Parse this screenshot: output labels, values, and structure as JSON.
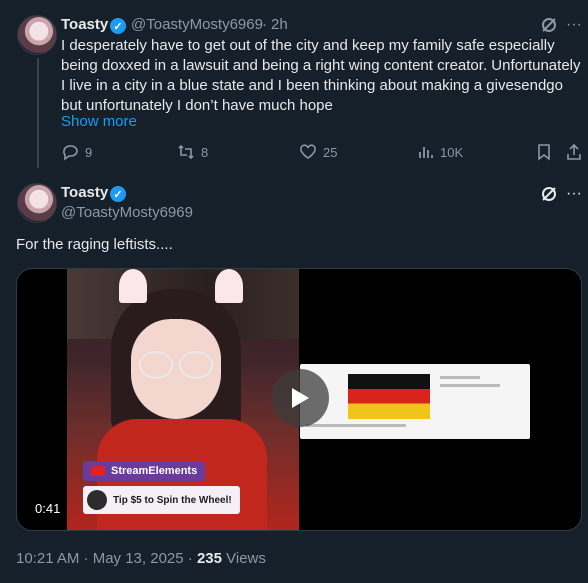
{
  "reply_tweet": {
    "display_name": "Toasty",
    "handle": "@ToastyMosty6969",
    "separator": "·",
    "time_ago": "2h",
    "text": "I desperately have to get out of the city and keep my family safe especially being doxxed in a lawsuit and being a right wing content creator. Unfortunately I live in a city in a blue state and I been thinking about making a givesendgo but unfortunately I don’t have much hope",
    "show_more": "Show more",
    "stats": {
      "replies": "9",
      "reposts": "8",
      "likes": "25",
      "views": "10K"
    }
  },
  "main_tweet": {
    "display_name": "Toasty",
    "handle": "@ToastyMosty6969",
    "text": "For the raging leftists....",
    "video": {
      "duration": "0:41",
      "overlay_badge": "StreamElements",
      "overlay_tip": "Tip $5 to Spin the Wheel!"
    },
    "timestamp": "10:21 AM · May 13, 2025 · ",
    "views_count": "235",
    "views_label": " Views"
  },
  "colors": {
    "background": "#15202b",
    "text": "#e7e9ea",
    "muted": "#8b98a5",
    "accent": "#1d9bf0"
  },
  "icons": [
    "grok-icon",
    "more-icon",
    "reply-icon",
    "repost-icon",
    "like-icon",
    "views-icon",
    "bookmark-icon",
    "share-icon",
    "verified-icon",
    "play-icon"
  ]
}
